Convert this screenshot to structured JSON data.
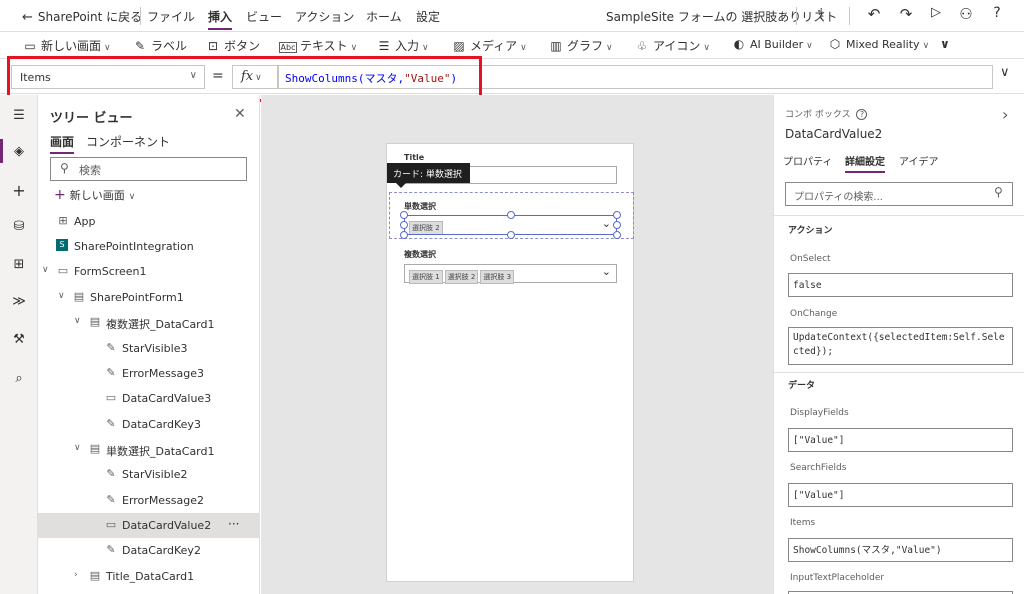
{
  "menubar": {
    "back": "SharePoint に戻る",
    "items": [
      "ファイル",
      "挿入",
      "ビュー",
      "アクション",
      "ホーム",
      "設定"
    ],
    "active": "挿入",
    "app_title": "SampleSite フォームの 選択肢ありリスト"
  },
  "ribbon": {
    "items": [
      {
        "label": "新しい画面",
        "icon": "new-screen-icon"
      },
      {
        "label": "ラベル",
        "icon": "label-icon"
      },
      {
        "label": "ボタン",
        "icon": "button-icon"
      },
      {
        "label": "テキスト",
        "icon": "text-icon"
      },
      {
        "label": "入力",
        "icon": "input-icon"
      },
      {
        "label": "メディア",
        "icon": "media-icon"
      },
      {
        "label": "グラフ",
        "icon": "chart-icon"
      },
      {
        "label": "アイコン",
        "icon": "icons-icon"
      },
      {
        "label": "AI Builder",
        "icon": "ai-builder-icon"
      },
      {
        "label": "Mixed Reality",
        "icon": "mixed-reality-icon"
      }
    ]
  },
  "formula": {
    "property": "Items",
    "fx": "fx",
    "func": "ShowColumns(マスタ,",
    "str": "\"Value\"",
    "close": ")"
  },
  "tree": {
    "title": "ツリー ビュー",
    "tabs": [
      "画面",
      "コンポーネント"
    ],
    "search_placeholder": "検索",
    "new_screen": "新しい画面",
    "rows": [
      {
        "label": "App",
        "level": 0
      },
      {
        "label": "SharePointIntegration",
        "level": 0
      },
      {
        "label": "FormScreen1",
        "level": 0
      },
      {
        "label": "SharePointForm1",
        "level": 1
      },
      {
        "label": "複数選択_DataCard1",
        "level": 2
      },
      {
        "label": "StarVisible3",
        "level": 3
      },
      {
        "label": "ErrorMessage3",
        "level": 3
      },
      {
        "label": "DataCardValue3",
        "level": 3
      },
      {
        "label": "DataCardKey3",
        "level": 3
      },
      {
        "label": "単数選択_DataCard1",
        "level": 2
      },
      {
        "label": "StarVisible2",
        "level": 3
      },
      {
        "label": "ErrorMessage2",
        "level": 3
      },
      {
        "label": "DataCardValue2",
        "level": 3
      },
      {
        "label": "DataCardKey2",
        "level": 3
      },
      {
        "label": "Title_DataCard1",
        "level": 2
      }
    ],
    "selected": "DataCardValue2",
    "more": "···"
  },
  "canvas": {
    "title_label": "Title",
    "tooltip": "カード: 単数選択",
    "single_label": "単数選択",
    "single_tags": [
      "選択肢 2"
    ],
    "multi_label": "複数選択",
    "multi_tags": [
      "選択肢 1",
      "選択肢 2",
      "選択肢 3"
    ]
  },
  "props": {
    "control_type": "コンボ ボックス",
    "control_name": "DataCardValue2",
    "tabs": [
      "プロパティ",
      "詳細設定",
      "アイデア"
    ],
    "active_tab": "詳細設定",
    "search_placeholder": "プロパティの検索...",
    "sections": [
      {
        "title": "アクション"
      },
      {
        "title": "データ"
      }
    ],
    "fields": [
      {
        "label": "OnSelect",
        "value": "false"
      },
      {
        "label": "OnChange",
        "value": "UpdateContext({selectedItem:Self.Selected});"
      },
      {
        "label": "DisplayFields",
        "value": "[\"Value\"]"
      },
      {
        "label": "SearchFields",
        "value": "[\"Value\"]"
      },
      {
        "label": "Items",
        "value": "ShowColumns(マスタ,\"Value\")"
      },
      {
        "label": "InputTextPlaceholder",
        "value": ""
      }
    ]
  },
  "colors": {
    "accent": "#742774",
    "highlight": "#e81123",
    "selection": "#5b6ad0"
  }
}
